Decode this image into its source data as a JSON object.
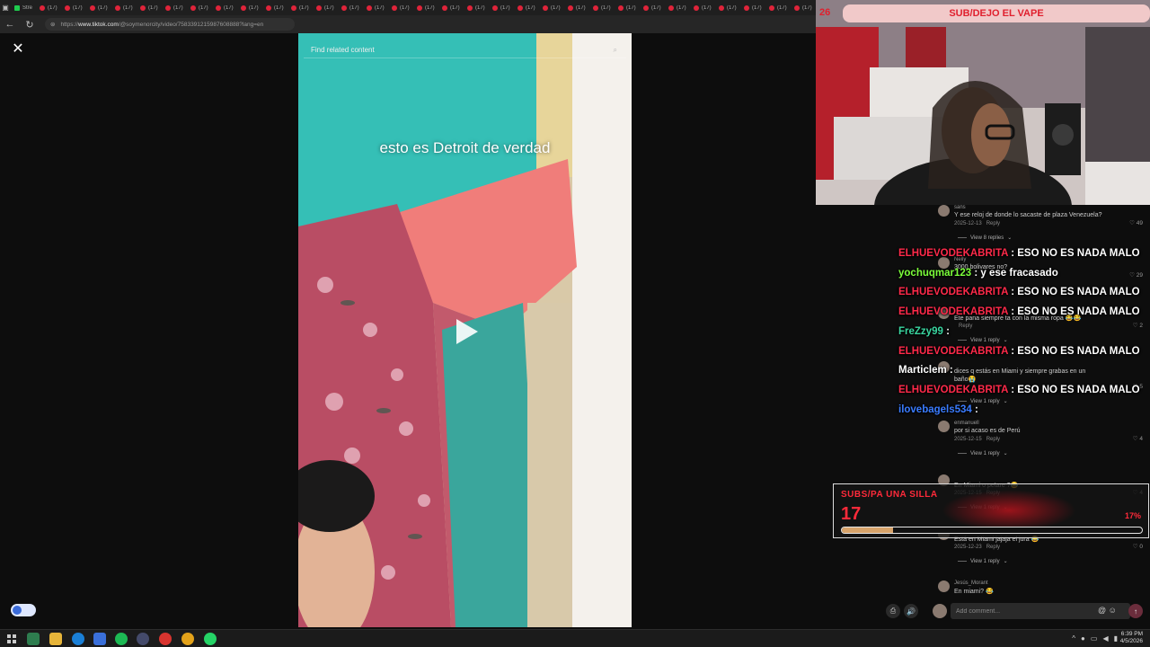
{
  "browser": {
    "tabs": [
      "Stre",
      "(17)",
      "(17)",
      "(17)",
      "(17)",
      "(17)",
      "(17)",
      "(17)",
      "(17)",
      "(17)",
      "(17)",
      "(17)",
      "(17)",
      "(17)",
      "(17)",
      "(17)",
      "(17)",
      "(17)",
      "(17)",
      "(17)",
      "(17)",
      "(17)",
      "(17)",
      "(17)",
      "(17)",
      "(17)",
      "(17)",
      "(17)",
      "(17)",
      "(17)",
      "(17)",
      "(17)"
    ],
    "url_prefix": "https://",
    "url_domain": "www.tiktok.com",
    "url_rest": "/@soymenorcity/video/7583391215987608888?lang=en"
  },
  "video": {
    "search_placeholder": "Find related content",
    "caption": "esto es Detroit de verdad"
  },
  "stream": {
    "header_title": "SUB/DEJO EL VAPE",
    "header_count": "26"
  },
  "comments": [
    {
      "user": "sans",
      "text": "Y ese reloj de donde lo sacaste de plaza Venezuela?",
      "date": "2025-12-13",
      "reply": "Reply",
      "likes": "49",
      "view_replies": "View 8 replies"
    },
    {
      "user": "Nelly",
      "text": "3000 bolivares no?",
      "date": "",
      "reply": "",
      "likes": "29",
      "view_replies": ""
    },
    {
      "user": "",
      "text": "Ete pana siempre ta con la misma ropa 😂😂",
      "date": "",
      "reply": "Reply",
      "likes": "2",
      "view_replies": "View 1 reply"
    },
    {
      "user": "",
      "text": "dices q estás en Miami y siempre grabas en un",
      "text2": "baño😭",
      "date": "",
      "reply": "",
      "likes": "5",
      "view_replies": "View 1 reply"
    },
    {
      "user": "enmanuell",
      "text": "por si acaso es de Perú",
      "date": "2025-12-15",
      "reply": "Reply",
      "likes": "4",
      "view_replies": "View 1 reply"
    },
    {
      "user": "",
      "text": "En Miami o petare ?😂",
      "date": "2025-12-15",
      "reply": "Reply",
      "likes": "4",
      "view_replies": "View 1 reply"
    },
    {
      "user": "",
      "text": "Está en Miami jajaja el jura 😂",
      "date": "2025-12-23",
      "reply": "Reply",
      "likes": "0",
      "view_replies": "View 1 reply"
    },
    {
      "user": "Jesús_Morant",
      "text": "En miami? 😂",
      "date": "",
      "reply": "",
      "likes": "",
      "view_replies": ""
    }
  ],
  "chat": [
    {
      "name": "ELHUEVODEKABRITA",
      "text": ": ESO NO ES NADA MALO",
      "color": "#ff2a4a"
    },
    {
      "name": "yochuqmar123",
      "text": ": y ese fracasado",
      "color": "#7cff3a"
    },
    {
      "name": "ELHUEVODEKABRITA",
      "text": ": ESO NO ES NADA MALO",
      "color": "#ff2a4a"
    },
    {
      "name": "ELHUEVODEKABRITA",
      "text": ": ESO NO ES NADA MALO",
      "color": "#ff2a4a"
    },
    {
      "name": "FreZzy99",
      "text": ":",
      "color": "#3ad6a0"
    },
    {
      "name": "ELHUEVODEKABRITA",
      "text": ": ESO NO ES NADA MALO",
      "color": "#ff2a4a"
    },
    {
      "name": "Marticlem",
      "text": ":",
      "color": "#ffffff"
    },
    {
      "name": "ELHUEVODEKABRITA",
      "text": ": ESO NO ES NADA MALO",
      "color": "#ff2a4a"
    },
    {
      "name": "ilovebagels534",
      "text": ":",
      "color": "#3a7cff"
    }
  ],
  "goal": {
    "label": "SUBS/PA UNA SILLA",
    "count": "17",
    "percent_text": "17%",
    "progress": 0.17
  },
  "comment_input": {
    "placeholder": "Add comment..."
  },
  "taskbar": {
    "time": "6:39 PM",
    "date": "4/5/2026"
  }
}
